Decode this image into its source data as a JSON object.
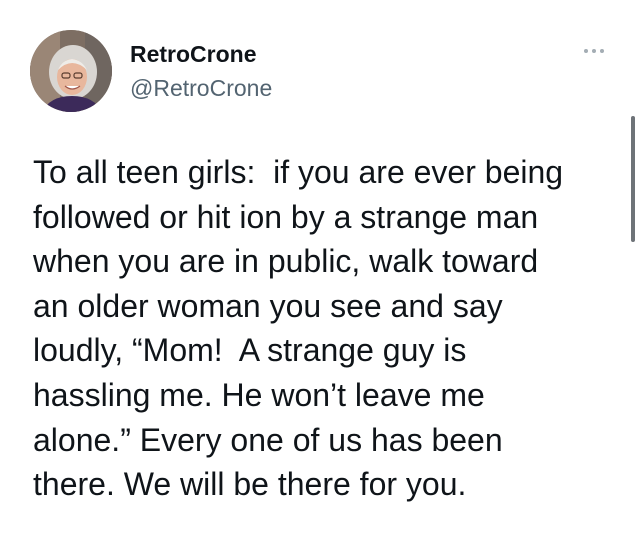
{
  "tweet": {
    "author": {
      "display_name": "RetroCrone",
      "handle": "@RetroCrone",
      "avatar_icon": "profile-photo"
    },
    "more_icon": "more-options-icon",
    "text_lines": [
      "To all teen girls:  if you are ever being",
      "followed or hit ion by a strange man",
      "when you are in public, walk toward",
      "an older woman you see and say",
      "loudly, “Mom!  A strange guy is",
      "hassling me. He won’t leave me",
      "alone.” Every one of us has been",
      "there. We will be there for you."
    ]
  },
  "colors": {
    "text": "#0f1419",
    "handle": "#536471",
    "dots": "#a4adb4",
    "scrollbar": "#6e7378"
  }
}
